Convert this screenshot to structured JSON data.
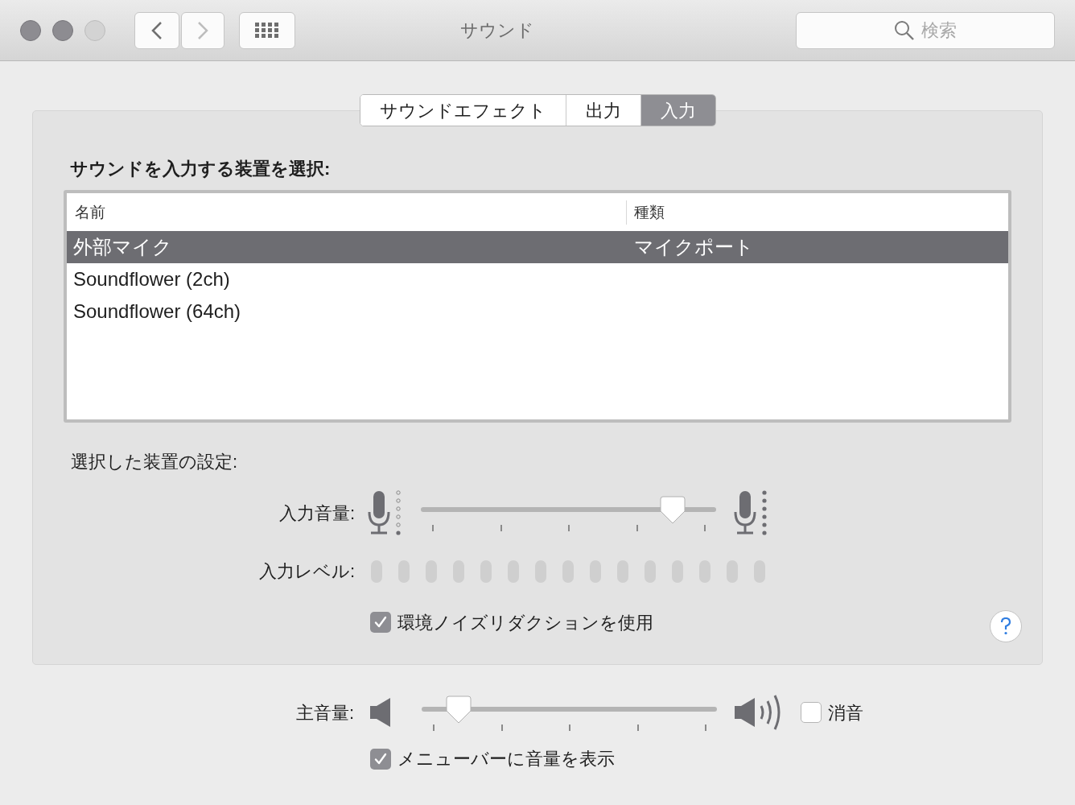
{
  "window": {
    "title": "サウンド",
    "back_disabled": false,
    "forward_disabled": true,
    "search": {
      "placeholder": "検索"
    }
  },
  "tabs": [
    {
      "label": "サウンドエフェクト",
      "selected": false
    },
    {
      "label": "出力",
      "selected": false
    },
    {
      "label": "入力",
      "selected": true
    }
  ],
  "device_section": {
    "heading": "サウンドを入力する装置を選択:",
    "table": {
      "columns": [
        "名前",
        "種類"
      ],
      "rows": [
        {
          "name": "外部マイク",
          "type": "マイクポート",
          "selected": true
        },
        {
          "name": "Soundflower (2ch)",
          "selected": false
        },
        {
          "name": "Soundflower (64ch)",
          "selected": false
        }
      ]
    }
  },
  "settings": {
    "heading": "選択した装置の設定:",
    "input_volume": {
      "label": "入力音量:",
      "level": 0.88
    },
    "input_level": {
      "label": "入力レベル:"
    },
    "noise_reduction": {
      "label": "環境ノイズリダクションを使用",
      "checked": true
    }
  },
  "output": {
    "volume": {
      "label": "主音量:",
      "level": 0.09
    },
    "mute": {
      "label": "消音",
      "checked": false
    },
    "show_in_menu_bar": {
      "label": "メニューバーに音量を表示",
      "checked": true
    }
  }
}
